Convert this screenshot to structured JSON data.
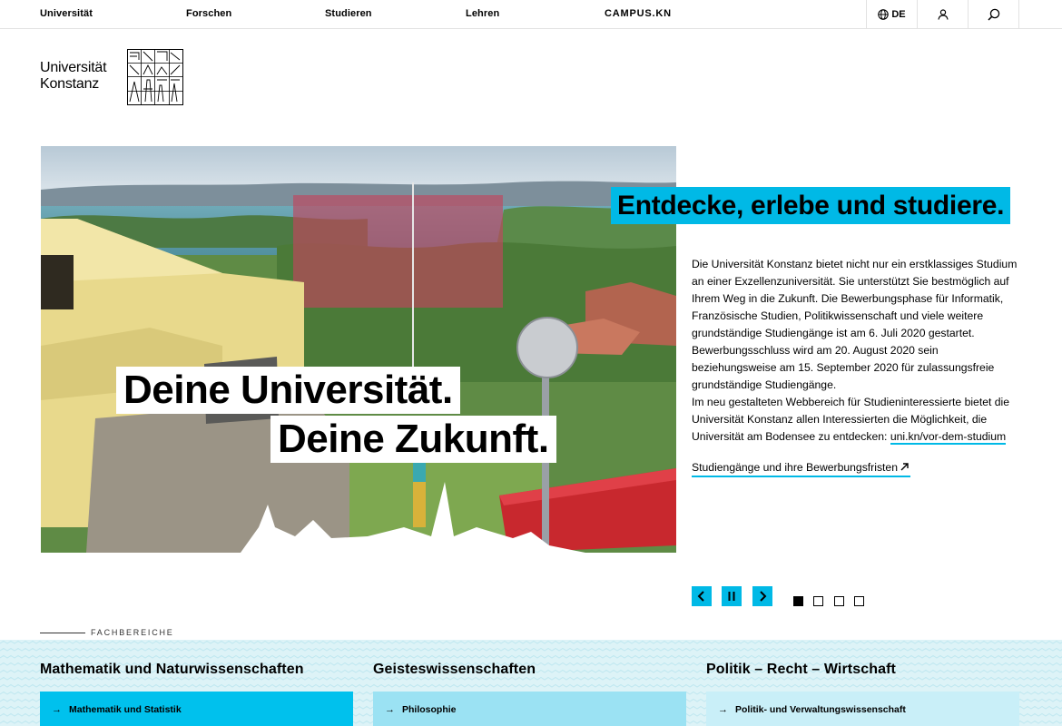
{
  "nav": {
    "items": [
      "Universität",
      "Forschen",
      "Studieren",
      "Lehren",
      "CAMPUS.KN"
    ],
    "language": "DE",
    "language_icon": "globe-icon",
    "account_icon": "user-icon",
    "search_icon": "search-icon"
  },
  "logo": {
    "line1": "Universität",
    "line2": "Konstanz"
  },
  "hero": {
    "line1": "Deine Universität.",
    "line2": "Deine Zukunft."
  },
  "teaser": {
    "headline": "Entdecke, erlebe und studiere.",
    "paragraph1": "Die Universität Konstanz bietet nicht nur ein erstklassiges Studium an einer Exzellenzuniversität. Sie unterstützt Sie bestmöglich auf Ihrem Weg in die Zukunft. Die Bewerbungsphase für Informatik, Französische Studien, Politikwissenschaft und viele weitere grundständige Studiengänge ist am 6. Juli 2020 gestartet. Bewerbungsschluss wird am 20. August 2020 sein beziehungsweise am 15. September 2020 für zulassungsfreie grundständige Studiengänge.",
    "paragraph2": "Im neu gestalteten Webbereich für Studieninteressierte bietet die Universität Konstanz allen Interessierten die Möglichkeit, die Universität am Bodensee zu entdecken: ",
    "paragraph2_link": "uni.kn/vor-dem-studium",
    "cta": "Studiengänge und ihre Bewerbungsfristen",
    "cta_icon": "arrow-up-right-icon"
  },
  "slider": {
    "prev_icon": "chevron-left-icon",
    "pause_icon": "pause-icon",
    "next_icon": "chevron-right-icon",
    "slide_count": 4,
    "active_slide": 1
  },
  "faculties": {
    "heading": "FACHBEREICHE",
    "columns": [
      {
        "title": "Mathematik und Naturwissenschaften",
        "first_item": "Mathematik und Statistik",
        "card_color": "#00c1ed"
      },
      {
        "title": "Geisteswissenschaften",
        "first_item": "Philosophie",
        "card_color": "#9be2f3"
      },
      {
        "title": "Politik – Recht – Wirtschaft",
        "first_item": "Politik- und Verwaltungswissenschaft",
        "card_color": "#c9eff8"
      }
    ]
  },
  "colors": {
    "accent": "#00b9e6"
  }
}
